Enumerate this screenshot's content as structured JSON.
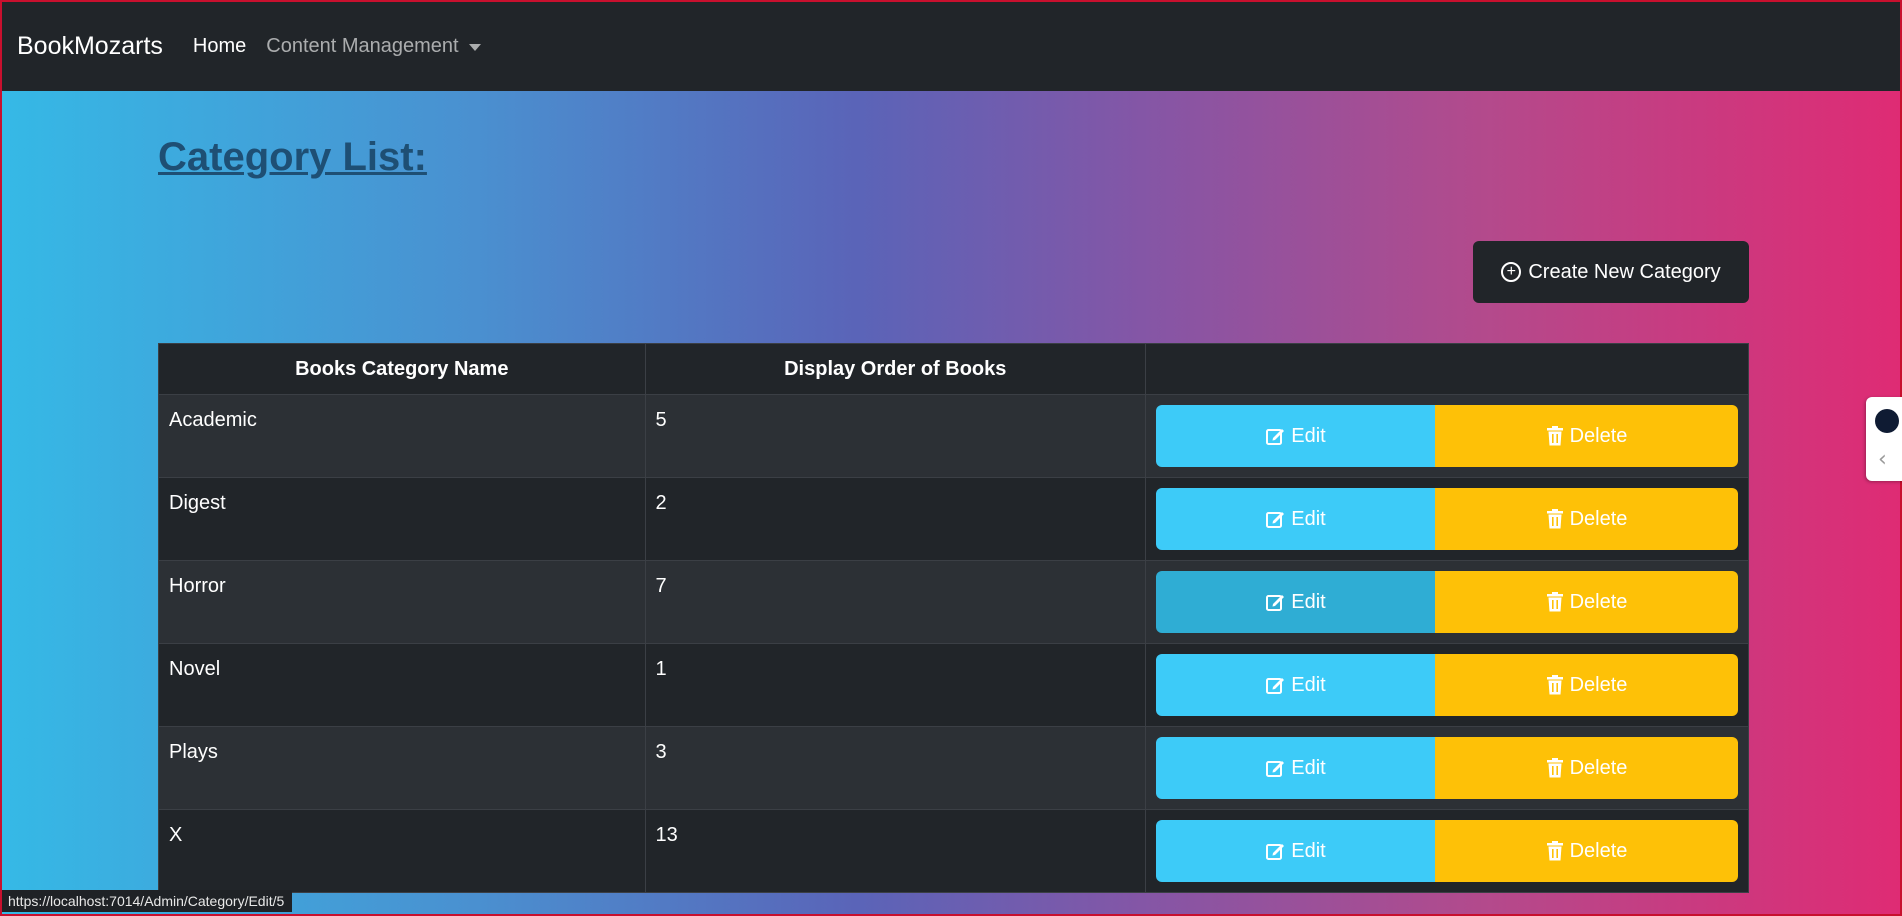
{
  "navbar": {
    "brand": "BookMozarts",
    "home": "Home",
    "content_management": "Content Management"
  },
  "page": {
    "title": "Category List:",
    "create_button": "Create New Category"
  },
  "table": {
    "headers": [
      "Books Category Name",
      "Display Order of Books",
      ""
    ],
    "rows": [
      {
        "name": "Academic",
        "order": "5"
      },
      {
        "name": "Digest",
        "order": "2"
      },
      {
        "name": "Horror",
        "order": "7"
      },
      {
        "name": "Novel",
        "order": "1"
      },
      {
        "name": "Plays",
        "order": "3"
      },
      {
        "name": "X",
        "order": "13"
      }
    ],
    "edit_label": "Edit",
    "delete_label": "Delete"
  },
  "status_bar": {
    "url": "https://localhost:7014/Admin/Category/Edit/5"
  },
  "colors": {
    "edit": "#3dcbf8",
    "delete": "#fec107",
    "navbar": "#212529"
  },
  "icons": {
    "create": "plus-circle-icon",
    "edit": "edit-icon",
    "delete": "trash-icon"
  }
}
